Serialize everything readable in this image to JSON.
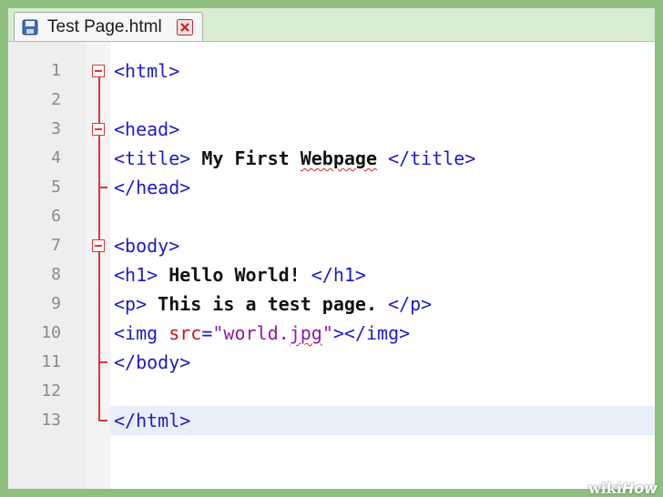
{
  "tab": {
    "title": "Test Page.html"
  },
  "line_numbers": [
    "1",
    "2",
    "3",
    "4",
    "5",
    "6",
    "7",
    "8",
    "9",
    "10",
    "11",
    "12",
    "13"
  ],
  "code": {
    "l1_tag": "<html>",
    "l3_tag": "<head>",
    "l4_open": "<title>",
    "l4_text_a": " My First ",
    "l4_text_b": "Webpage",
    "l4_close": " </title>",
    "l5_tag": "</head>",
    "l7_tag": "<body>",
    "l8_open": "<h1>",
    "l8_text": " Hello World! ",
    "l8_close": "</h1>",
    "l9_open": "<p>",
    "l9_text": " This is a test page. ",
    "l9_close": "</p>",
    "l10_open": "<img ",
    "l10_attr": "src",
    "l10_eq": "=",
    "l10_str_a": "\"world.",
    "l10_str_b": "jpg",
    "l10_str_c": "\"",
    "l10_close": "></img>",
    "l11_tag": "</body>",
    "l13_tag": "</html>"
  },
  "watermark": {
    "a": "wiki",
    "b": "How"
  },
  "colors": {
    "tag": "#1c1cc8",
    "attr": "#cc1010",
    "string": "#8c1aa8",
    "fold": "#e23636",
    "current_line": "#e9eefb"
  }
}
